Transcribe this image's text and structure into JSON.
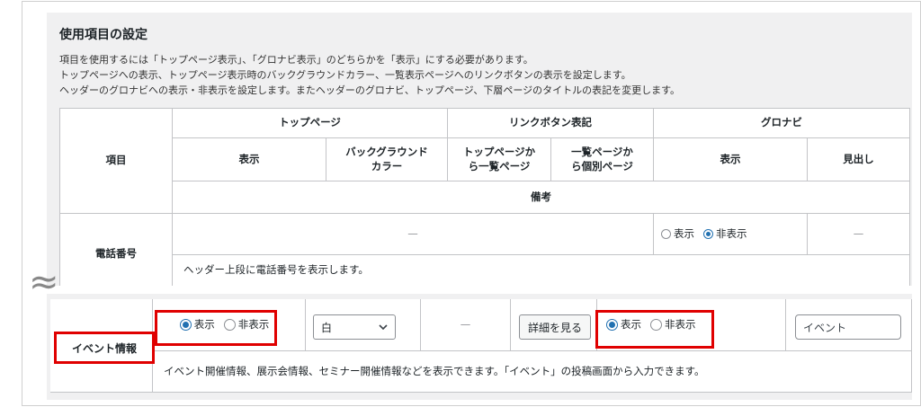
{
  "section": {
    "title": "使用項目の設定",
    "desc": [
      "項目を使用するには「トップページ表示」、「グロナビ表示」のどちらかを「表示」にする必要があります。",
      "トップページへの表示、トップページ表示時のバックグラウンドカラー、一覧表示ページへのリンクボタンの表示を設定します。",
      "ヘッダーのグロナビへの表示・非表示を設定します。またヘッダーのグロナビ、トップページ、下層ページのタイトルの表記を変更します。"
    ]
  },
  "table": {
    "col_item": "項目",
    "group_top": "トップページ",
    "group_link": "リンクボタン表記",
    "group_gnav": "グロナビ",
    "col_display": "表示",
    "col_bg": "バックグラウンド\nカラー",
    "col_top_to_list": "トップページか\nら一覧ページ",
    "col_list_to_single": "一覧ページか\nら個別ページ",
    "col_gnav_display": "表示",
    "col_heading": "見出し",
    "col_note": "備考"
  },
  "row_phone": {
    "label": "電話番号",
    "dash_top": "—",
    "radio_show": "表示",
    "radio_hide": "非表示",
    "selected": "非表示",
    "dash_heading": "—",
    "note": "ヘッダー上段に電話番号を表示します。"
  },
  "row_event": {
    "label": "イベント情報",
    "radio_show": "表示",
    "radio_hide": "非表示",
    "top_selected": "表示",
    "bg_select": "白",
    "dash_link": "—",
    "detail_button": "詳細を見る",
    "gnav_selected": "表示",
    "heading_value": "イベント",
    "note": "イベント開催情報、展示会情報、セミナー開催情報などを表示できます。「イベント」の投稿画面から入力できます。"
  },
  "decor": {
    "tilde": "≈"
  },
  "colors": {
    "accent": "#2271b1",
    "highlight": "#e00000"
  }
}
